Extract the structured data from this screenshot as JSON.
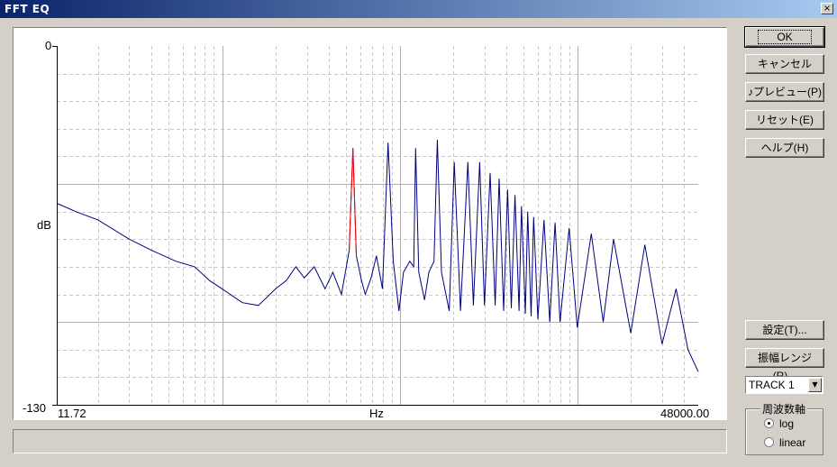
{
  "window": {
    "title": "FFT EQ",
    "close_glyph": "×"
  },
  "chart": {
    "y_top": "0",
    "y_bottom": "-130",
    "y_unit": "dB",
    "x_left": "11.72",
    "x_right": "48000.00",
    "x_unit": "Hz"
  },
  "buttons": {
    "ok": "OK",
    "cancel": "キャンセル",
    "preview": "♪プレビュー(P)",
    "reset": "リセット(E)",
    "help": "ヘルプ(H)",
    "settings": "設定(T)...",
    "range": "振幅レンジ(R)..."
  },
  "track_select": {
    "value": "TRACK 1"
  },
  "axis_group": {
    "title": "周波数軸",
    "options": [
      {
        "label": "log",
        "selected": true
      },
      {
        "label": "linear",
        "selected": false
      }
    ]
  },
  "colors": {
    "spectrum": "#000080",
    "highlight": "#ff0000",
    "grid": "#c0c0c0"
  },
  "chart_data": {
    "type": "line",
    "x_scale": "log",
    "xlim": [
      11.72,
      48000
    ],
    "ylim": [
      -130,
      0
    ],
    "xlabel": "Hz",
    "ylabel": "dB",
    "grid": true,
    "series": [
      {
        "values": [
          [
            11.72,
            -57
          ],
          [
            15,
            -60
          ],
          [
            20,
            -63
          ],
          [
            30,
            -70
          ],
          [
            40,
            -74
          ],
          [
            55,
            -78
          ],
          [
            70,
            -80
          ],
          [
            85,
            -85
          ],
          [
            100,
            -88
          ],
          [
            130,
            -93
          ],
          [
            160,
            -94
          ],
          [
            200,
            -88
          ],
          [
            230,
            -85
          ],
          [
            260,
            -80
          ],
          [
            290,
            -84
          ],
          [
            330,
            -80
          ],
          [
            380,
            -88
          ],
          [
            420,
            -82
          ],
          [
            470,
            -90
          ],
          [
            520,
            -74
          ],
          [
            545,
            -37
          ],
          [
            570,
            -76
          ],
          [
            610,
            -85
          ],
          [
            640,
            -90
          ],
          [
            690,
            -84
          ],
          [
            740,
            -76
          ],
          [
            800,
            -88
          ],
          [
            860,
            -35
          ],
          [
            920,
            -78
          ],
          [
            990,
            -96
          ],
          [
            1050,
            -82
          ],
          [
            1140,
            -78
          ],
          [
            1200,
            -80
          ],
          [
            1230,
            -37
          ],
          [
            1280,
            -82
          ],
          [
            1380,
            -92
          ],
          [
            1460,
            -82
          ],
          [
            1560,
            -78
          ],
          [
            1630,
            -34
          ],
          [
            1720,
            -82
          ],
          [
            1900,
            -96
          ],
          [
            2030,
            -42
          ],
          [
            2200,
            -96
          ],
          [
            2420,
            -42
          ],
          [
            2600,
            -94
          ],
          [
            2820,
            -42
          ],
          [
            3000,
            -94
          ],
          [
            3230,
            -46
          ],
          [
            3450,
            -94
          ],
          [
            3630,
            -48
          ],
          [
            3850,
            -96
          ],
          [
            4050,
            -52
          ],
          [
            4250,
            -95
          ],
          [
            4460,
            -54
          ],
          [
            4700,
            -96
          ],
          [
            4850,
            -58
          ],
          [
            5100,
            -97
          ],
          [
            5260,
            -60
          ],
          [
            5500,
            -98
          ],
          [
            5680,
            -62
          ],
          [
            6000,
            -99
          ],
          [
            6500,
            -63
          ],
          [
            7000,
            -100
          ],
          [
            7500,
            -64
          ],
          [
            8000,
            -100
          ],
          [
            9000,
            -66
          ],
          [
            10000,
            -102
          ],
          [
            12000,
            -68
          ],
          [
            14000,
            -100
          ],
          [
            16000,
            -70
          ],
          [
            20000,
            -104
          ],
          [
            24000,
            -72
          ],
          [
            30000,
            -108
          ],
          [
            36000,
            -88
          ],
          [
            42000,
            -110
          ],
          [
            48000,
            -118
          ]
        ]
      }
    ],
    "highlight_range": [
      520,
      580
    ]
  }
}
